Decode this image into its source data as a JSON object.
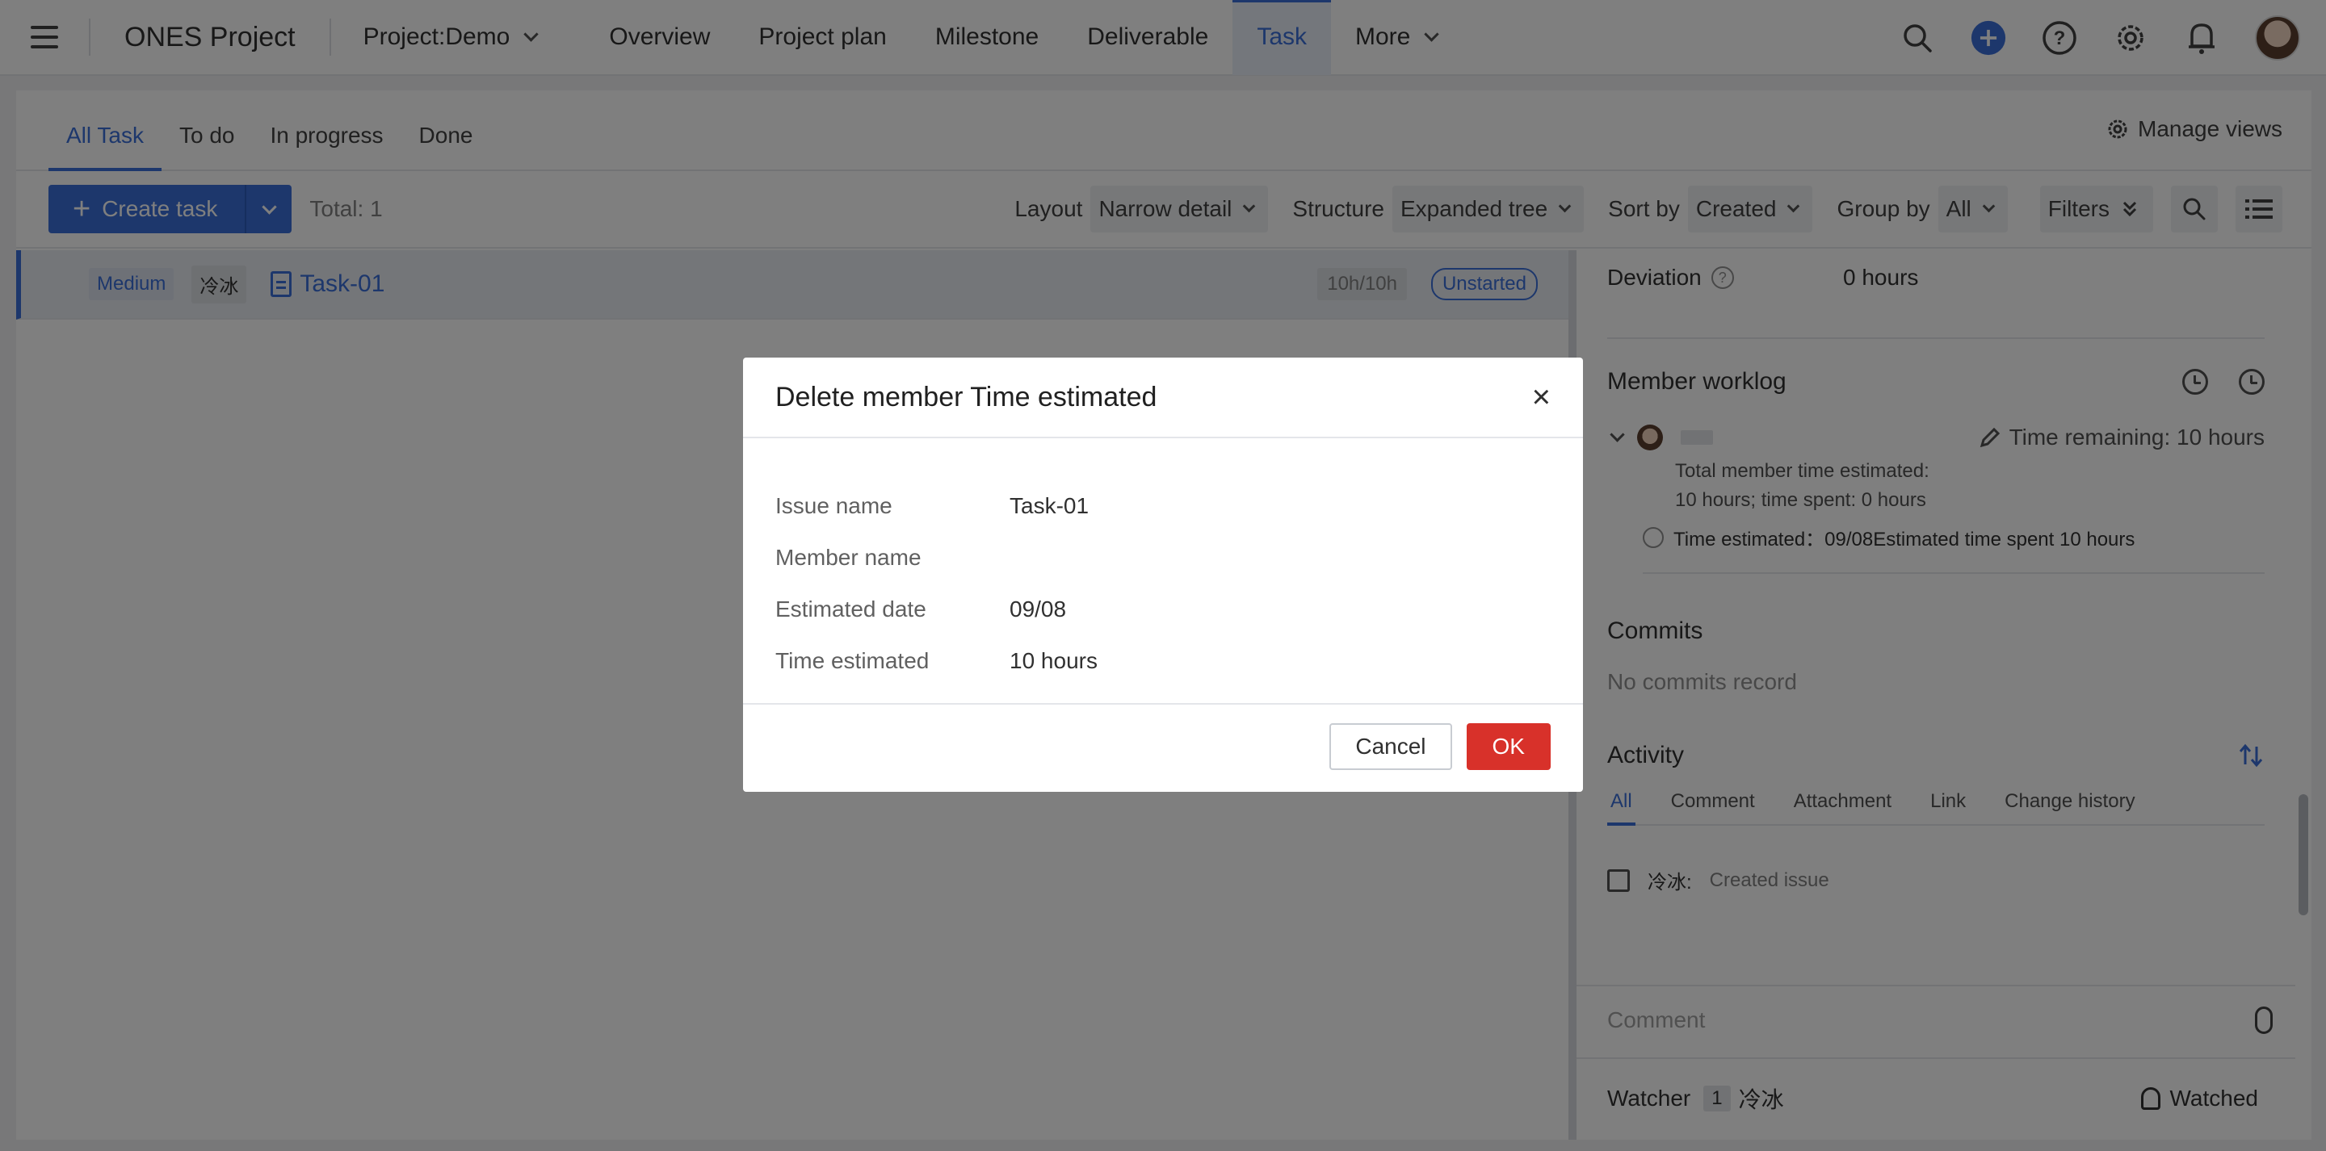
{
  "topnav": {
    "app_title": "ONES Project",
    "project_selector": "Project:Demo",
    "links": [
      "Overview",
      "Project plan",
      "Milestone",
      "Deliverable",
      "Task",
      "More"
    ],
    "active_link": "Task"
  },
  "tabs": {
    "items": [
      "All Task",
      "To do",
      "In progress",
      "Done"
    ],
    "active": "All Task",
    "manage_views": "Manage views"
  },
  "toolbar": {
    "create_label": "Create task",
    "total": "Total: 1",
    "layout_label": "Layout",
    "layout_value": "Narrow detail",
    "structure_label": "Structure",
    "structure_value": "Expanded tree",
    "sort_label": "Sort by",
    "sort_value": "Created",
    "group_label": "Group by",
    "group_value": "All",
    "filters_label": "Filters"
  },
  "task_list": {
    "rows": [
      {
        "priority": "Medium",
        "assignee": "冷冰",
        "name": "Task-01",
        "hours": "10h/10h",
        "status": "Unstarted"
      }
    ]
  },
  "detail": {
    "deviation_label": "Deviation",
    "deviation_value": "0 hours",
    "worklog_title": "Member worklog",
    "time_remaining": "Time remaining: 10 hours",
    "total_estimated_line1": "Total member time estimated:",
    "total_estimated_line2": "10 hours; time spent: 0 hours",
    "worklog_entry": "Time estimated：09/08Estimated time spent 10 hours",
    "commits_title": "Commits",
    "commits_empty": "No commits record",
    "activity_title": "Activity",
    "activity_tabs": [
      "All",
      "Comment",
      "Attachment",
      "Link",
      "Change history"
    ],
    "activity_active": "All",
    "activity_who": "冷冰:",
    "activity_what": "Created issue",
    "comment_placeholder": "Comment",
    "watcher_label": "Watcher",
    "watcher_count": "1",
    "watcher_name": "冷冰",
    "watched_label": "Watched"
  },
  "modal": {
    "title": "Delete member Time estimated",
    "close": "×",
    "fields": [
      {
        "label": "Issue name",
        "value": "Task-01"
      },
      {
        "label": "Member name",
        "value": ""
      },
      {
        "label": "Estimated date",
        "value": "09/08"
      },
      {
        "label": "Time estimated",
        "value": "10 hours"
      }
    ],
    "cancel_label": "Cancel",
    "ok_label": "OK"
  },
  "colors": {
    "accent": "#3a6fd8",
    "danger": "#d8312a"
  }
}
